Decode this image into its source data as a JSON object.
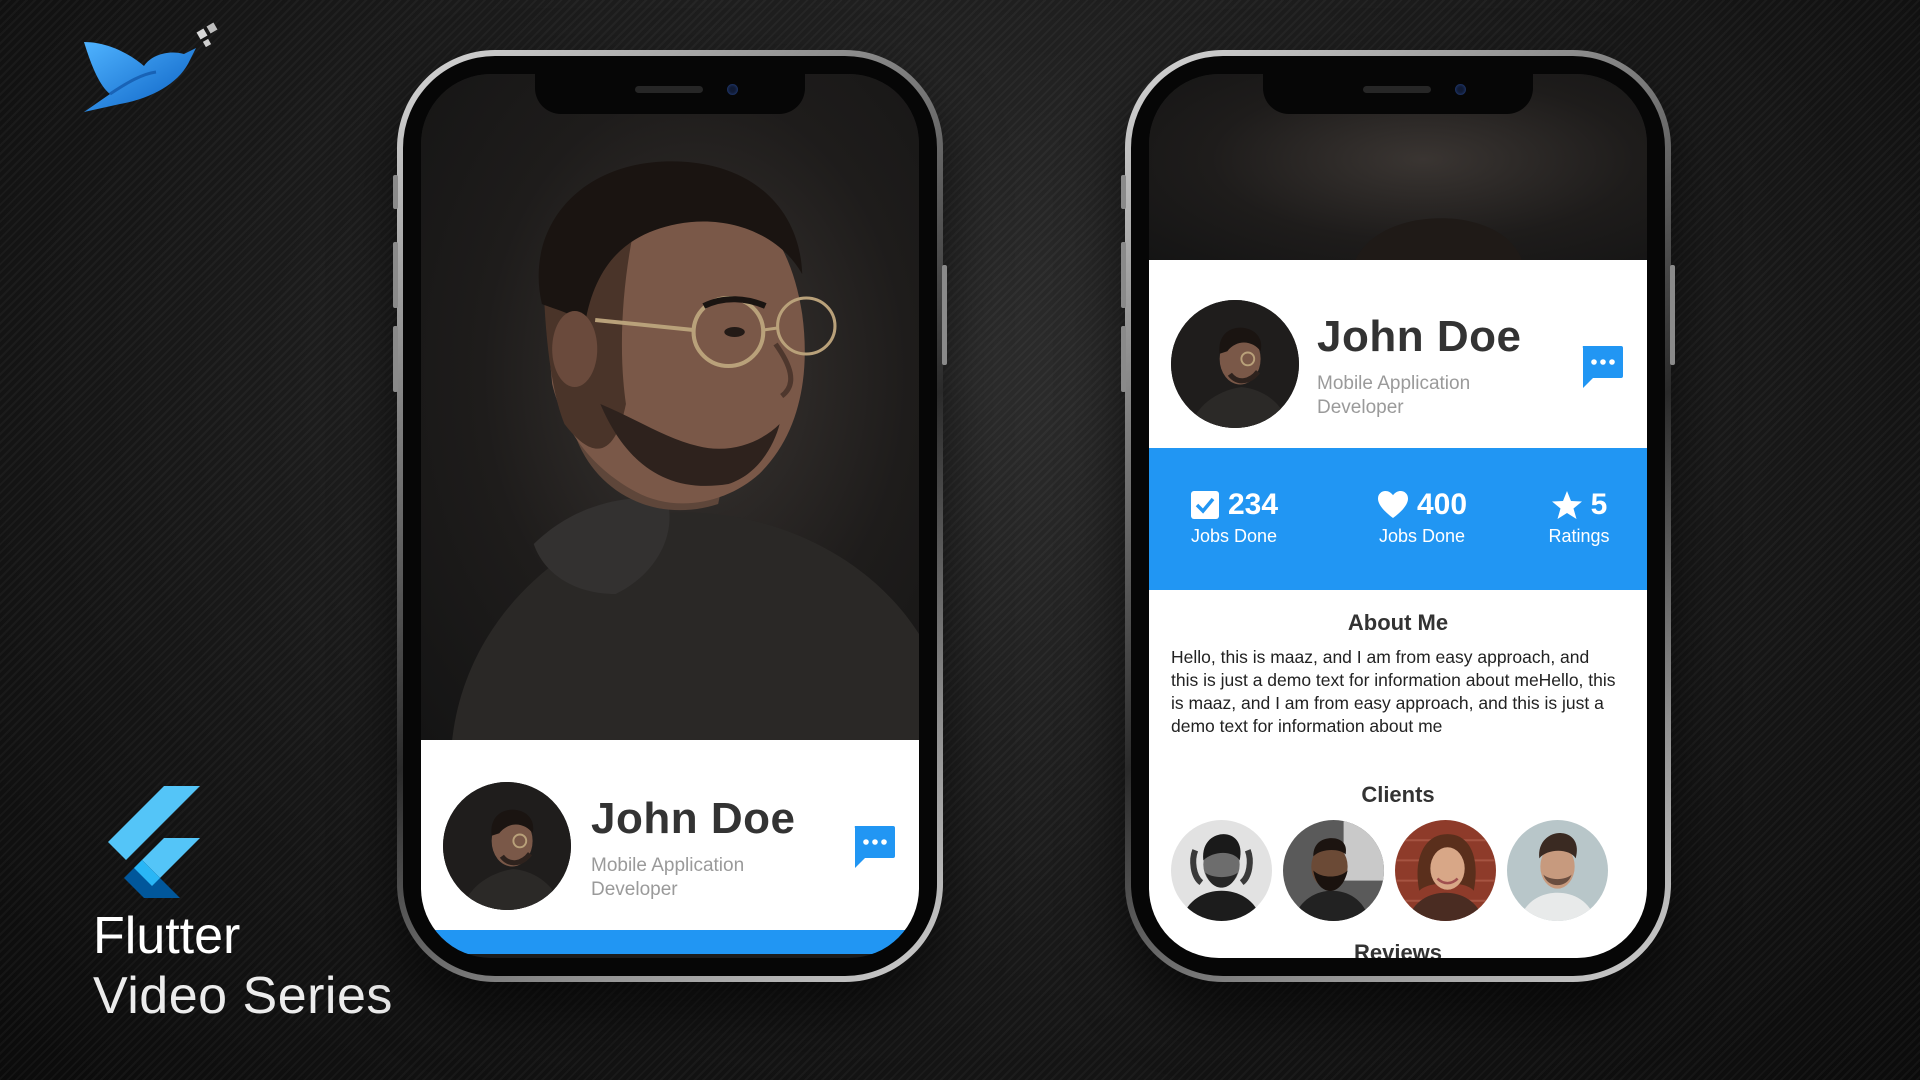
{
  "brand": {
    "logo_icon": "bird-logo-icon",
    "flutter_icon": "flutter-logo-icon",
    "title": "Flutter",
    "subtitle": "Video Series"
  },
  "colors": {
    "accent": "#2196f3",
    "name_text": "#333333",
    "role_text": "#9a9a9a",
    "card_bg": "#ffffff",
    "background": "#151515"
  },
  "left_phone": {
    "profile": {
      "name": "John Doe",
      "role": "Mobile Application Developer",
      "message_icon": "chat-bubble-icon"
    }
  },
  "right_phone": {
    "profile": {
      "name": "John Doe",
      "role": "Mobile Application Developer",
      "message_icon": "chat-bubble-icon"
    },
    "stats": [
      {
        "icon": "checkbox-icon",
        "value": "234",
        "label": "Jobs Done"
      },
      {
        "icon": "heart-icon",
        "value": "400",
        "label": "Jobs Done"
      },
      {
        "icon": "star-icon",
        "value": "5",
        "label": "Ratings"
      }
    ],
    "about": {
      "title": "About Me",
      "text": "Hello, this is maaz, and I am from easy approach, and this is just a demo text for information about meHello, this is maaz, and I am from easy approach, and this is just a demo text for information about me"
    },
    "clients": {
      "title": "Clients",
      "avatars": [
        "client-avatar-1",
        "client-avatar-2",
        "client-avatar-3",
        "client-avatar-4"
      ]
    },
    "reviews": {
      "title": "Reviews"
    }
  }
}
